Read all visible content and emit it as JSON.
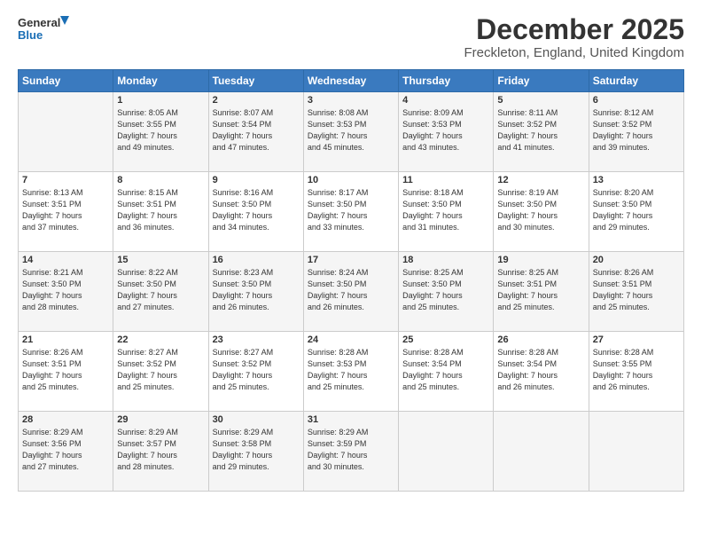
{
  "logo": {
    "line1": "General",
    "line2": "Blue"
  },
  "title": "December 2025",
  "subtitle": "Freckleton, England, United Kingdom",
  "headers": [
    "Sunday",
    "Monday",
    "Tuesday",
    "Wednesday",
    "Thursday",
    "Friday",
    "Saturday"
  ],
  "weeks": [
    [
      {
        "day": "",
        "info": ""
      },
      {
        "day": "1",
        "info": "Sunrise: 8:05 AM\nSunset: 3:55 PM\nDaylight: 7 hours\nand 49 minutes."
      },
      {
        "day": "2",
        "info": "Sunrise: 8:07 AM\nSunset: 3:54 PM\nDaylight: 7 hours\nand 47 minutes."
      },
      {
        "day": "3",
        "info": "Sunrise: 8:08 AM\nSunset: 3:53 PM\nDaylight: 7 hours\nand 45 minutes."
      },
      {
        "day": "4",
        "info": "Sunrise: 8:09 AM\nSunset: 3:53 PM\nDaylight: 7 hours\nand 43 minutes."
      },
      {
        "day": "5",
        "info": "Sunrise: 8:11 AM\nSunset: 3:52 PM\nDaylight: 7 hours\nand 41 minutes."
      },
      {
        "day": "6",
        "info": "Sunrise: 8:12 AM\nSunset: 3:52 PM\nDaylight: 7 hours\nand 39 minutes."
      }
    ],
    [
      {
        "day": "7",
        "info": "Sunrise: 8:13 AM\nSunset: 3:51 PM\nDaylight: 7 hours\nand 37 minutes."
      },
      {
        "day": "8",
        "info": "Sunrise: 8:15 AM\nSunset: 3:51 PM\nDaylight: 7 hours\nand 36 minutes."
      },
      {
        "day": "9",
        "info": "Sunrise: 8:16 AM\nSunset: 3:50 PM\nDaylight: 7 hours\nand 34 minutes."
      },
      {
        "day": "10",
        "info": "Sunrise: 8:17 AM\nSunset: 3:50 PM\nDaylight: 7 hours\nand 33 minutes."
      },
      {
        "day": "11",
        "info": "Sunrise: 8:18 AM\nSunset: 3:50 PM\nDaylight: 7 hours\nand 31 minutes."
      },
      {
        "day": "12",
        "info": "Sunrise: 8:19 AM\nSunset: 3:50 PM\nDaylight: 7 hours\nand 30 minutes."
      },
      {
        "day": "13",
        "info": "Sunrise: 8:20 AM\nSunset: 3:50 PM\nDaylight: 7 hours\nand 29 minutes."
      }
    ],
    [
      {
        "day": "14",
        "info": "Sunrise: 8:21 AM\nSunset: 3:50 PM\nDaylight: 7 hours\nand 28 minutes."
      },
      {
        "day": "15",
        "info": "Sunrise: 8:22 AM\nSunset: 3:50 PM\nDaylight: 7 hours\nand 27 minutes."
      },
      {
        "day": "16",
        "info": "Sunrise: 8:23 AM\nSunset: 3:50 PM\nDaylight: 7 hours\nand 26 minutes."
      },
      {
        "day": "17",
        "info": "Sunrise: 8:24 AM\nSunset: 3:50 PM\nDaylight: 7 hours\nand 26 minutes."
      },
      {
        "day": "18",
        "info": "Sunrise: 8:25 AM\nSunset: 3:50 PM\nDaylight: 7 hours\nand 25 minutes."
      },
      {
        "day": "19",
        "info": "Sunrise: 8:25 AM\nSunset: 3:51 PM\nDaylight: 7 hours\nand 25 minutes."
      },
      {
        "day": "20",
        "info": "Sunrise: 8:26 AM\nSunset: 3:51 PM\nDaylight: 7 hours\nand 25 minutes."
      }
    ],
    [
      {
        "day": "21",
        "info": "Sunrise: 8:26 AM\nSunset: 3:51 PM\nDaylight: 7 hours\nand 25 minutes."
      },
      {
        "day": "22",
        "info": "Sunrise: 8:27 AM\nSunset: 3:52 PM\nDaylight: 7 hours\nand 25 minutes."
      },
      {
        "day": "23",
        "info": "Sunrise: 8:27 AM\nSunset: 3:52 PM\nDaylight: 7 hours\nand 25 minutes."
      },
      {
        "day": "24",
        "info": "Sunrise: 8:28 AM\nSunset: 3:53 PM\nDaylight: 7 hours\nand 25 minutes."
      },
      {
        "day": "25",
        "info": "Sunrise: 8:28 AM\nSunset: 3:54 PM\nDaylight: 7 hours\nand 25 minutes."
      },
      {
        "day": "26",
        "info": "Sunrise: 8:28 AM\nSunset: 3:54 PM\nDaylight: 7 hours\nand 26 minutes."
      },
      {
        "day": "27",
        "info": "Sunrise: 8:28 AM\nSunset: 3:55 PM\nDaylight: 7 hours\nand 26 minutes."
      }
    ],
    [
      {
        "day": "28",
        "info": "Sunrise: 8:29 AM\nSunset: 3:56 PM\nDaylight: 7 hours\nand 27 minutes."
      },
      {
        "day": "29",
        "info": "Sunrise: 8:29 AM\nSunset: 3:57 PM\nDaylight: 7 hours\nand 28 minutes."
      },
      {
        "day": "30",
        "info": "Sunrise: 8:29 AM\nSunset: 3:58 PM\nDaylight: 7 hours\nand 29 minutes."
      },
      {
        "day": "31",
        "info": "Sunrise: 8:29 AM\nSunset: 3:59 PM\nDaylight: 7 hours\nand 30 minutes."
      },
      {
        "day": "",
        "info": ""
      },
      {
        "day": "",
        "info": ""
      },
      {
        "day": "",
        "info": ""
      }
    ]
  ]
}
